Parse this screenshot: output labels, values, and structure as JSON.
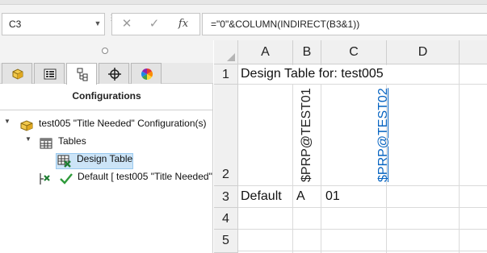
{
  "formula_bar": {
    "name_box": "C3",
    "cancel_icon": "cancel-x-icon",
    "enter_icon": "checkmark-icon",
    "fx_label": "fx",
    "formula": "=\"0\"&COLUMN(INDIRECT(B3&1))"
  },
  "panel": {
    "tabs": [
      {
        "name": "featuremanager-tab",
        "icon": "part-icon",
        "active": false
      },
      {
        "name": "propertymanager-tab",
        "icon": "property-list-icon",
        "active": false
      },
      {
        "name": "configurationmanager-tab",
        "icon": "configuration-tree-icon",
        "active": true
      },
      {
        "name": "dimxpert-tab",
        "icon": "crosshair-icon",
        "active": false
      },
      {
        "name": "display-manager-tab",
        "icon": "color-wheel-icon",
        "active": false
      }
    ],
    "title": "Configurations",
    "tree": {
      "root": "test005 \"Title Needed\" Configuration(s)",
      "tables": "Tables",
      "design_table": "Design Table",
      "default_config": "Default [ test005 \"Title Needed\""
    }
  },
  "sheet": {
    "columns": [
      "A",
      "B",
      "C",
      "D"
    ],
    "rows": [
      "1",
      "2",
      "3",
      "4",
      "5"
    ],
    "cells": {
      "A1": "Design Table for: test005",
      "B2": "$PRP@TEST01",
      "C2": "$PRP@TEST02",
      "A3": "Default",
      "B3": "A",
      "C3": "01"
    },
    "link_color": "#0563c1",
    "selection_highlight": "#cce4f7"
  }
}
